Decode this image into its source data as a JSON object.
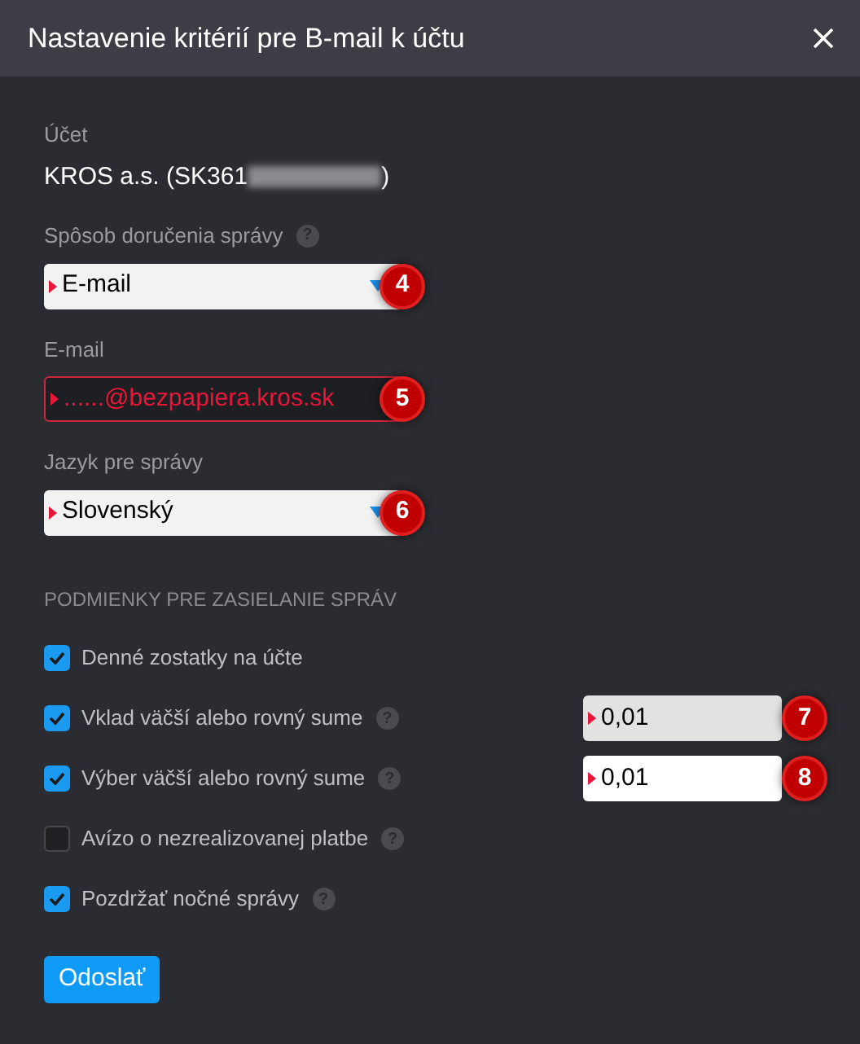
{
  "dialog": {
    "title": "Nastavenie kritérií pre B-mail k účtu"
  },
  "account": {
    "label": "Účet",
    "value": "KROS a.s. (SK361",
    "value_end": ")"
  },
  "fields": [
    {
      "kind": "select",
      "label": "Spôsob doručenia správy",
      "help": "?",
      "value": "E-mail",
      "invalid": false,
      "callout": "4"
    },
    {
      "kind": "input",
      "label": "E-mail",
      "value": "......@bezpapiera.kros.sk",
      "invalid": true,
      "callout": "5"
    },
    {
      "kind": "select",
      "label": "Jazyk pre správy",
      "value": "Slovenský",
      "invalid": false,
      "callout": "6"
    }
  ],
  "section_title": "PODMIENKY PRE ZASIELANIE SPRÁV",
  "options": [
    {
      "label": "Denné zostatky na účte",
      "checked": true
    },
    {
      "label": "Vklad väčší alebo rovný sume",
      "help": "?",
      "checked": true,
      "amount": {
        "value": "0,01",
        "focused": false,
        "callout": "7"
      }
    },
    {
      "label": "Výber väčší alebo rovný sume",
      "help": "?",
      "checked": true,
      "amount": {
        "value": "0,01",
        "focused": true,
        "callout": "8"
      }
    },
    {
      "label": "Avízo o nezrealizovanej platbe",
      "help": "?",
      "checked": false
    },
    {
      "label": "Pozdržať nočné správy",
      "help": "?",
      "checked": true
    }
  ],
  "submit": "Odoslať"
}
